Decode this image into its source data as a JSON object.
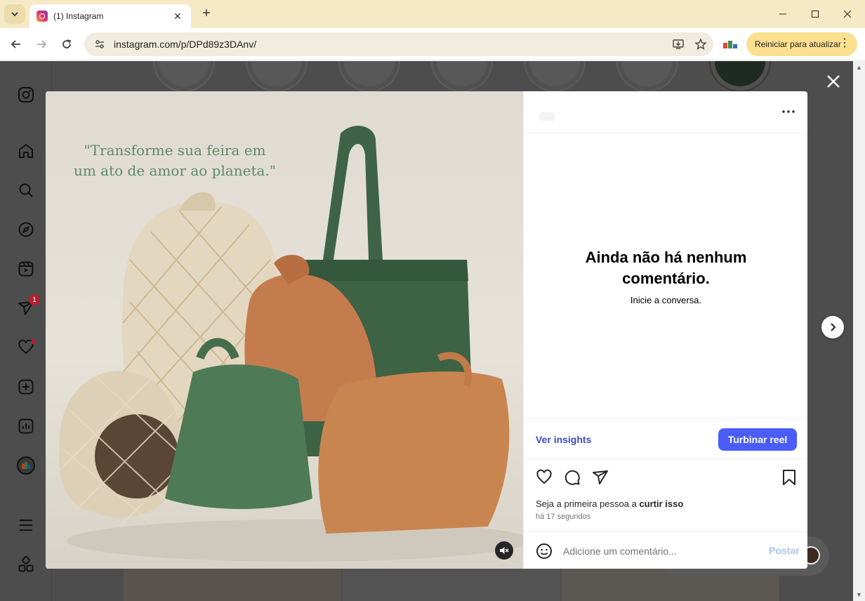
{
  "browser": {
    "tab_title": "(1) Instagram",
    "url": "instagram.com/p/DPd89z3DAnv/",
    "update_button_label": "Reiniciar para atualizar",
    "icons": [
      "tab-menu-icon",
      "instagram-favicon",
      "close-icon",
      "plus-icon",
      "minimize-icon",
      "maximize-icon",
      "back-icon",
      "forward-icon",
      "reload-icon",
      "site-settings-icon",
      "install-app-icon",
      "star-icon",
      "extension-icon",
      "kebab-menu-icon"
    ]
  },
  "sidebar": {
    "items": [
      {
        "name": "instagram-logo-icon"
      },
      {
        "name": "home-icon"
      },
      {
        "name": "search-icon"
      },
      {
        "name": "explore-icon"
      },
      {
        "name": "reels-icon"
      },
      {
        "name": "messages-icon",
        "badge": "1"
      },
      {
        "name": "notifications-icon"
      },
      {
        "name": "create-icon"
      },
      {
        "name": "dashboard-icon"
      },
      {
        "name": "profile-avatar-icon"
      },
      {
        "name": "more-menu-icon"
      },
      {
        "name": "also-from-meta-icon"
      }
    ]
  },
  "post": {
    "quote_line1": "\"Transforme sua feira em",
    "quote_line2": "um ato de amor ao planeta.\"",
    "empty_title_line1": "Ainda não há nenhum",
    "empty_title_line2": "comentário.",
    "empty_subtitle": "Inicie a conversa.",
    "insights_label": "Ver insights",
    "boost_label": "Turbinar reel",
    "likes_prefix": "Seja a primeira pessoa a ",
    "likes_bold": "curtir isso",
    "timestamp": "há 17 segundos",
    "comment_placeholder": "Adicione um comentário...",
    "post_label": "Postar"
  },
  "colors": {
    "boost_button": "#4a5df9",
    "insights_link": "#3b4bc8",
    "post_button_disabled": "#a8c6f2",
    "update_button": "#fbe08f",
    "titlebar": "#f6eac6",
    "quote_text": "#5e8a6a"
  }
}
